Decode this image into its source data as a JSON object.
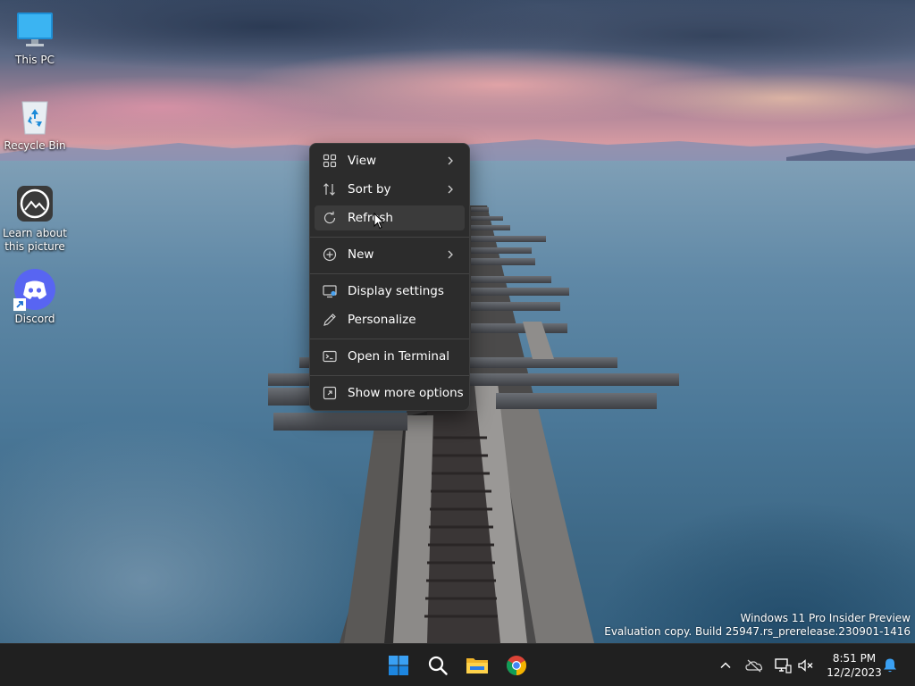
{
  "desktop": {
    "icons": [
      {
        "label": "This PC",
        "icon": "monitor-icon"
      },
      {
        "label": "Recycle Bin",
        "icon": "recycle-bin-icon"
      },
      {
        "label": "Learn about this picture",
        "icon": "camera-icon"
      },
      {
        "label": "Discord",
        "icon": "discord-icon"
      }
    ]
  },
  "context_menu": {
    "items": [
      {
        "label": "View",
        "icon": "grid-icon",
        "has_submenu": true
      },
      {
        "label": "Sort by",
        "icon": "sort-icon",
        "has_submenu": true
      },
      {
        "label": "Refresh",
        "icon": "refresh-icon",
        "has_submenu": false,
        "hovered": true
      },
      {
        "label": "New",
        "icon": "plus-circle-icon",
        "has_submenu": true
      },
      {
        "label": "Display settings",
        "icon": "display-icon",
        "has_submenu": false
      },
      {
        "label": "Personalize",
        "icon": "pen-icon",
        "has_submenu": false
      },
      {
        "label": "Open in Terminal",
        "icon": "terminal-icon",
        "has_submenu": false
      },
      {
        "label": "Show more options",
        "icon": "expand-icon",
        "has_submenu": false
      }
    ]
  },
  "watermark": {
    "line1": "Windows 11 Pro Insider Preview",
    "line2": "Evaluation copy. Build 25947.rs_prerelease.230901-1416"
  },
  "taskbar": {
    "apps": [
      "start-icon",
      "search-icon",
      "file-explorer-icon",
      "chrome-icon"
    ],
    "tray": [
      "chevron-up-icon",
      "onedrive-icon",
      "network-icon",
      "volume-muted-icon",
      "notification-bell-icon"
    ],
    "time": "8:51 PM",
    "date": "12/2/2023"
  },
  "colors": {
    "menu_bg": "#2c2c2c",
    "menu_hover": "#3b3b3b",
    "taskbar_bg": "#202020",
    "accent": "#0078d4"
  }
}
